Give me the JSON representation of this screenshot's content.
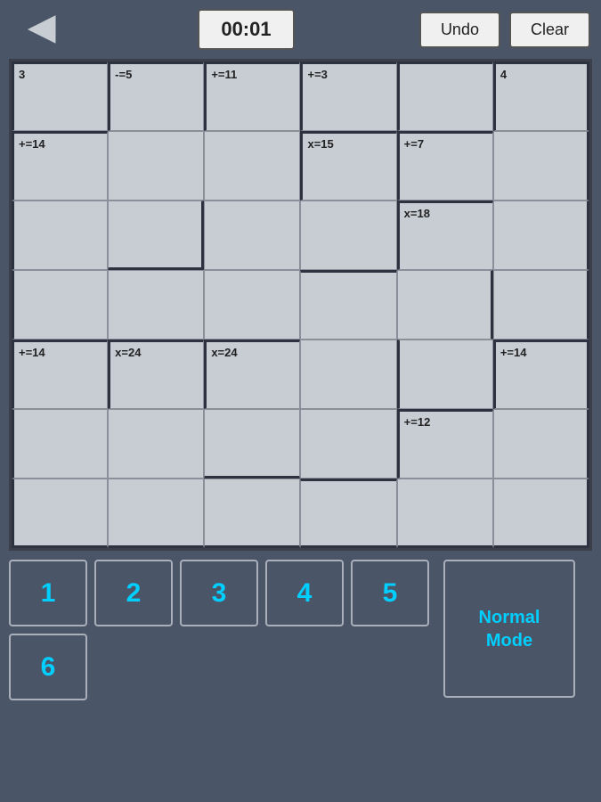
{
  "header": {
    "back_label": "◁",
    "timer": "00:01",
    "undo_label": "Undo",
    "clear_label": "Clear"
  },
  "puzzle": {
    "rows": 7,
    "cols": 6
  },
  "cells": [
    {
      "id": "r0c0",
      "label": "3",
      "row": 1,
      "col": 1,
      "bt": true,
      "bl": true,
      "br": false,
      "bb": false
    },
    {
      "id": "r0c1",
      "label": "-=5",
      "row": 1,
      "col": 2,
      "bt": true,
      "bl": true,
      "br": false,
      "bb": false
    },
    {
      "id": "r0c2",
      "label": "+=11",
      "row": 1,
      "col": 3,
      "bt": true,
      "bl": true,
      "br": false,
      "bb": false
    },
    {
      "id": "r0c3",
      "label": "+=3",
      "row": 1,
      "col": 4,
      "bt": true,
      "bl": true,
      "br": false,
      "bb": false
    },
    {
      "id": "r0c4",
      "label": "",
      "row": 1,
      "col": 5,
      "bt": true,
      "bl": true,
      "br": false,
      "bb": false
    },
    {
      "id": "r0c5",
      "label": "4",
      "row": 1,
      "col": 6,
      "bt": true,
      "bl": true,
      "br": true,
      "bb": false
    },
    {
      "id": "r1c0",
      "label": "+=14",
      "row": 2,
      "col": 1,
      "bt": true,
      "bl": true,
      "br": false,
      "bb": false
    },
    {
      "id": "r1c1",
      "label": "",
      "row": 2,
      "col": 2,
      "bt": false,
      "bl": false,
      "br": false,
      "bb": false
    },
    {
      "id": "r1c2",
      "label": "",
      "row": 2,
      "col": 3,
      "bt": false,
      "bl": false,
      "br": false,
      "bb": false
    },
    {
      "id": "r1c3",
      "label": "x=15",
      "row": 2,
      "col": 4,
      "bt": true,
      "bl": true,
      "br": false,
      "bb": false
    },
    {
      "id": "r1c4",
      "label": "+=7",
      "row": 2,
      "col": 5,
      "bt": true,
      "bl": true,
      "br": false,
      "bb": false
    },
    {
      "id": "r1c5",
      "label": "",
      "row": 2,
      "col": 6,
      "bt": false,
      "bl": false,
      "br": true,
      "bb": false
    },
    {
      "id": "r2c0",
      "label": "",
      "row": 3,
      "col": 1,
      "bt": false,
      "bl": true,
      "br": false,
      "bb": false
    },
    {
      "id": "r2c1",
      "label": "",
      "row": 3,
      "col": 2,
      "bt": false,
      "bl": false,
      "br": true,
      "bb": true
    },
    {
      "id": "r2c2",
      "label": "",
      "row": 3,
      "col": 3,
      "bt": false,
      "bl": false,
      "br": false,
      "bb": false
    },
    {
      "id": "r2c3",
      "label": "",
      "row": 3,
      "col": 4,
      "bt": false,
      "bl": false,
      "br": false,
      "bb": false
    },
    {
      "id": "r2c4",
      "label": "x=18",
      "row": 3,
      "col": 5,
      "bt": true,
      "bl": true,
      "br": false,
      "bb": false
    },
    {
      "id": "r2c5",
      "label": "",
      "row": 3,
      "col": 6,
      "bt": false,
      "bl": false,
      "br": true,
      "bb": false
    },
    {
      "id": "r3c0",
      "label": "",
      "row": 4,
      "col": 1,
      "bt": false,
      "bl": true,
      "br": false,
      "bb": false
    },
    {
      "id": "r3c1",
      "label": "",
      "row": 4,
      "col": 2,
      "bt": false,
      "bl": false,
      "br": false,
      "bb": false
    },
    {
      "id": "r3c2",
      "label": "",
      "row": 4,
      "col": 3,
      "bt": false,
      "bl": false,
      "br": false,
      "bb": false
    },
    {
      "id": "r3c3",
      "label": "",
      "row": 4,
      "col": 4,
      "bt": true,
      "bl": false,
      "br": false,
      "bb": false
    },
    {
      "id": "r3c4",
      "label": "",
      "row": 4,
      "col": 5,
      "bt": false,
      "bl": false,
      "br": true,
      "bb": false
    },
    {
      "id": "r3c5",
      "label": "",
      "row": 4,
      "col": 6,
      "bt": false,
      "bl": false,
      "br": true,
      "bb": false
    },
    {
      "id": "r4c0",
      "label": "+=14",
      "row": 5,
      "col": 1,
      "bt": true,
      "bl": true,
      "br": false,
      "bb": false
    },
    {
      "id": "r4c1",
      "label": "x=24",
      "row": 5,
      "col": 2,
      "bt": true,
      "bl": true,
      "br": false,
      "bb": false
    },
    {
      "id": "r4c2",
      "label": "x=24",
      "row": 5,
      "col": 3,
      "bt": true,
      "bl": true,
      "br": false,
      "bb": false
    },
    {
      "id": "r4c3",
      "label": "",
      "row": 5,
      "col": 4,
      "bt": false,
      "bl": false,
      "br": false,
      "bb": false
    },
    {
      "id": "r4c4",
      "label": "",
      "row": 5,
      "col": 5,
      "bt": false,
      "bl": true,
      "br": false,
      "bb": false
    },
    {
      "id": "r4c5",
      "label": "+=14",
      "row": 5,
      "col": 6,
      "bt": true,
      "bl": true,
      "br": true,
      "bb": false
    },
    {
      "id": "r5c0",
      "label": "",
      "row": 6,
      "col": 1,
      "bt": false,
      "bl": true,
      "br": false,
      "bb": false
    },
    {
      "id": "r5c1",
      "label": "",
      "row": 6,
      "col": 2,
      "bt": false,
      "bl": false,
      "br": false,
      "bb": false
    },
    {
      "id": "r5c2",
      "label": "",
      "row": 6,
      "col": 3,
      "bt": false,
      "bl": false,
      "br": false,
      "bb": true
    },
    {
      "id": "r5c3",
      "label": "",
      "row": 6,
      "col": 4,
      "bt": false,
      "bl": false,
      "br": false,
      "bb": false
    },
    {
      "id": "r5c4",
      "label": "+=12",
      "row": 6,
      "col": 5,
      "bt": true,
      "bl": true,
      "br": false,
      "bb": false
    },
    {
      "id": "r5c5",
      "label": "",
      "row": 6,
      "col": 6,
      "bt": false,
      "bl": false,
      "br": true,
      "bb": false
    },
    {
      "id": "r6c0",
      "label": "",
      "row": 7,
      "col": 1,
      "bt": false,
      "bl": true,
      "br": false,
      "bb": true
    },
    {
      "id": "r6c1",
      "label": "",
      "row": 7,
      "col": 2,
      "bt": false,
      "bl": false,
      "br": false,
      "bb": true
    },
    {
      "id": "r6c2",
      "label": "",
      "row": 7,
      "col": 3,
      "bt": false,
      "bl": false,
      "br": false,
      "bb": true
    },
    {
      "id": "r6c3",
      "label": "",
      "row": 7,
      "col": 4,
      "bt": true,
      "bl": false,
      "br": false,
      "bb": true
    },
    {
      "id": "r6c4",
      "label": "",
      "row": 7,
      "col": 5,
      "bt": false,
      "bl": false,
      "br": false,
      "bb": true
    },
    {
      "id": "r6c5",
      "label": "",
      "row": 7,
      "col": 6,
      "bt": false,
      "bl": false,
      "br": true,
      "bb": true
    }
  ],
  "numpad": {
    "digits": [
      "1",
      "2",
      "3",
      "4",
      "5",
      "6"
    ],
    "mode_label": "Normal\nMode"
  }
}
